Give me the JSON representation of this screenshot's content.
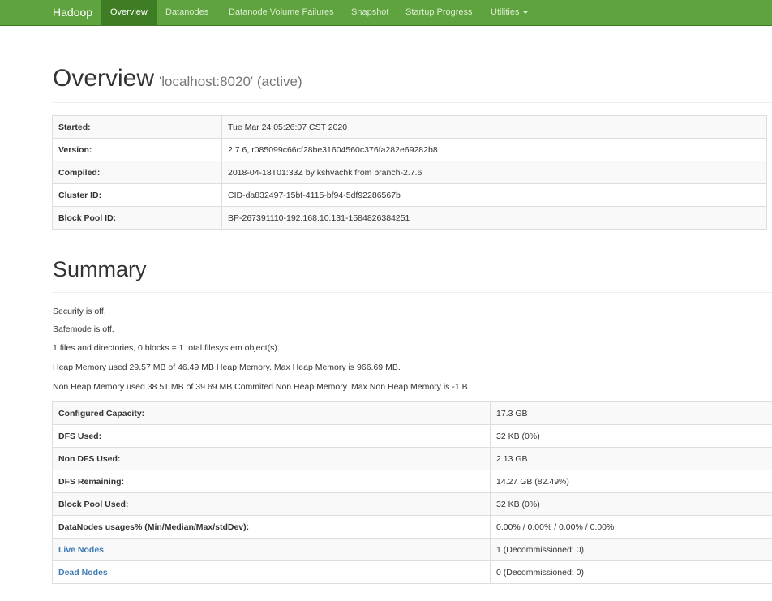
{
  "navbar": {
    "brand": "Hadoop",
    "items": [
      {
        "label": "Overview",
        "active": true
      },
      {
        "label": "Datanodes"
      },
      {
        "label": "Datanode Volume Failures"
      },
      {
        "label": "Snapshot"
      },
      {
        "label": "Startup Progress"
      },
      {
        "label": "Utilities",
        "dropdown": true
      }
    ],
    "colors": {
      "background": "#5fa33e",
      "active_background": "#3f7d24",
      "link": "#dbeed0"
    }
  },
  "overview": {
    "title": "Overview",
    "subtitle": "'localhost:8020' (active)",
    "rows": [
      {
        "key": "Started:",
        "value": "Tue Mar 24 05:26:07 CST 2020"
      },
      {
        "key": "Version:",
        "value": "2.7.6, r085099c66cf28be31604560c376fa282e69282b8"
      },
      {
        "key": "Compiled:",
        "value": "2018-04-18T01:33Z by kshvachk from branch-2.7.6"
      },
      {
        "key": "Cluster ID:",
        "value": "CID-da832497-15bf-4115-bf94-5df92286567b"
      },
      {
        "key": "Block Pool ID:",
        "value": "BP-267391110-192.168.10.131-1584826384251"
      }
    ]
  },
  "summary": {
    "title": "Summary",
    "lines": [
      "Security is off.",
      "Safemode is off.",
      "1 files and directories, 0 blocks = 1 total filesystem object(s).",
      "Heap Memory used 29.57 MB of 46.49 MB Heap Memory. Max Heap Memory is 966.69 MB.",
      "Non Heap Memory used 38.51 MB of 39.69 MB Commited Non Heap Memory. Max Non Heap Memory is -1 B."
    ],
    "rows": [
      {
        "key": "Configured Capacity:",
        "value": "17.3 GB"
      },
      {
        "key": "DFS Used:",
        "value": "32 KB (0%)"
      },
      {
        "key": "Non DFS Used:",
        "value": "2.13 GB"
      },
      {
        "key": "DFS Remaining:",
        "value": "14.27 GB (82.49%)"
      },
      {
        "key": "Block Pool Used:",
        "value": "32 KB (0%)"
      },
      {
        "key": "DataNodes usages% (Min/Median/Max/stdDev):",
        "value": "0.00% / 0.00% / 0.00% / 0.00%"
      },
      {
        "key": "Live Nodes",
        "value": "1 (Decommissioned: 0)",
        "link": true
      },
      {
        "key": "Dead Nodes",
        "value": "0 (Decommissioned: 0)",
        "link": true
      }
    ],
    "link_color": "#3f7db6"
  }
}
